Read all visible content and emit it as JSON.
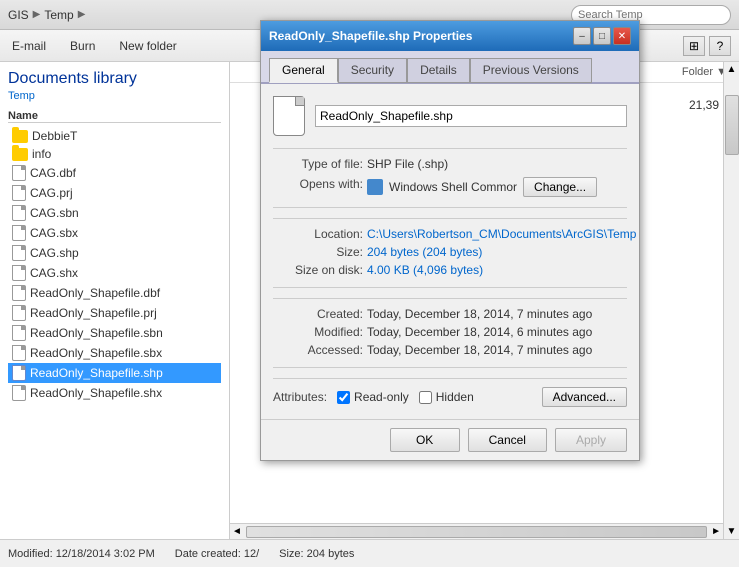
{
  "explorer": {
    "address": {
      "parts": [
        "GIS",
        "Temp"
      ],
      "arrows": [
        "▶",
        "▶"
      ]
    },
    "toolbar": {
      "email_label": "E-mail",
      "burn_label": "Burn",
      "new_folder_label": "New folder"
    },
    "sidebar": {
      "library_title": "Documents library",
      "library_subtitle": "Temp",
      "column_name": "Name"
    },
    "files": [
      {
        "name": "DebbieT",
        "type": "folder"
      },
      {
        "name": "info",
        "type": "folder"
      },
      {
        "name": "CAG.dbf",
        "type": "file"
      },
      {
        "name": "CAG.prj",
        "type": "file"
      },
      {
        "name": "CAG.sbn",
        "type": "file"
      },
      {
        "name": "CAG.sbx",
        "type": "file"
      },
      {
        "name": "CAG.shp",
        "type": "file"
      },
      {
        "name": "CAG.shx",
        "type": "file"
      },
      {
        "name": "ReadOnly_Shapefile.dbf",
        "type": "file"
      },
      {
        "name": "ReadOnly_Shapefile.prj",
        "type": "file"
      },
      {
        "name": "ReadOnly_Shapefile.sbn",
        "type": "file"
      },
      {
        "name": "ReadOnly_Shapefile.sbx",
        "type": "file"
      },
      {
        "name": "ReadOnly_Shapefile.shp",
        "type": "file",
        "selected": true
      },
      {
        "name": "ReadOnly_Shapefile.shx",
        "type": "file"
      }
    ],
    "size_column": "21,39",
    "status": {
      "modified": "Modified: 12/18/2014 3:02 PM",
      "date_created": "Date created: 12/",
      "size": "Size: 204 bytes"
    }
  },
  "dialog": {
    "title": "ReadOnly_Shapefile.shp Properties",
    "tabs": [
      "General",
      "Security",
      "Details",
      "Previous Versions"
    ],
    "active_tab": "General",
    "file_name": "ReadOnly_Shapefile.shp",
    "type_label": "Type of file:",
    "type_value": "SHP File (.shp)",
    "opens_with_label": "Opens with:",
    "opens_with_value": "Windows Shell Commor",
    "change_button": "Change...",
    "location_label": "Location:",
    "location_value": "C:\\Users\\Robertson_CM\\Documents\\ArcGIS\\Temp",
    "size_label": "Size:",
    "size_value": "204 bytes (204 bytes)",
    "size_on_disk_label": "Size on disk:",
    "size_on_disk_value": "4.00 KB (4,096 bytes)",
    "created_label": "Created:",
    "created_value": "Today, December 18, 2014, 7 minutes ago",
    "modified_label": "Modified:",
    "modified_value": "Today, December 18, 2014, 6 minutes ago",
    "accessed_label": "Accessed:",
    "accessed_value": "Today, December 18, 2014, 7 minutes ago",
    "attributes_label": "Attributes:",
    "readonly_label": "Read-only",
    "hidden_label": "Hidden",
    "advanced_button": "Advanced...",
    "ok_button": "OK",
    "cancel_button": "Cancel",
    "apply_button": "Apply",
    "window_controls": {
      "minimize": "–",
      "maximize": "□",
      "close": "✕"
    }
  }
}
